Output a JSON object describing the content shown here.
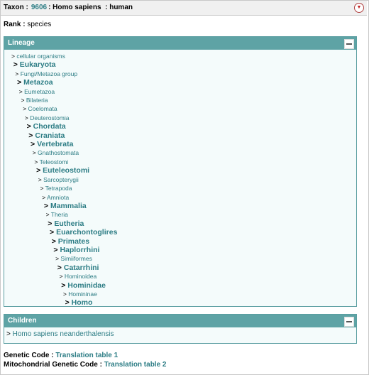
{
  "header": {
    "taxon_label": "Taxon :",
    "taxid": "9606",
    "name_sep": ": Homo sapiens",
    "common_sep": ": human"
  },
  "rank": {
    "label": "Rank :",
    "value": "species"
  },
  "lineage": {
    "title": "Lineage",
    "items": [
      {
        "name": "cellular organisms",
        "emph": false
      },
      {
        "name": "Eukaryota",
        "emph": true
      },
      {
        "name": "Fungi/Metazoa group",
        "emph": false
      },
      {
        "name": "Metazoa",
        "emph": true
      },
      {
        "name": "Eumetazoa",
        "emph": false
      },
      {
        "name": "Bilateria",
        "emph": false
      },
      {
        "name": "Coelomata",
        "emph": false
      },
      {
        "name": "Deuterostomia",
        "emph": false
      },
      {
        "name": "Chordata",
        "emph": true
      },
      {
        "name": "Craniata",
        "emph": true
      },
      {
        "name": "Vertebrata",
        "emph": true
      },
      {
        "name": "Gnathostomata",
        "emph": false
      },
      {
        "name": "Teleostomi",
        "emph": false
      },
      {
        "name": "Euteleostomi",
        "emph": true
      },
      {
        "name": "Sarcopterygii",
        "emph": false
      },
      {
        "name": "Tetrapoda",
        "emph": false
      },
      {
        "name": "Amniota",
        "emph": false
      },
      {
        "name": "Mammalia",
        "emph": true
      },
      {
        "name": "Theria",
        "emph": false
      },
      {
        "name": "Eutheria",
        "emph": true
      },
      {
        "name": "Euarchontoglires",
        "emph": true
      },
      {
        "name": "Primates",
        "emph": true
      },
      {
        "name": "Haplorrhini",
        "emph": true
      },
      {
        "name": "Simiiformes",
        "emph": false
      },
      {
        "name": "Catarrhini",
        "emph": true
      },
      {
        "name": "Hominoidea",
        "emph": false
      },
      {
        "name": "Hominidae",
        "emph": true
      },
      {
        "name": "Homininae",
        "emph": false
      },
      {
        "name": "Homo",
        "emph": true
      }
    ]
  },
  "children": {
    "title": "Children",
    "items": [
      {
        "name": "Homo sapiens neanderthalensis"
      }
    ]
  },
  "genetic_code": {
    "label": "Genetic Code :",
    "value": "Translation table 1"
  },
  "mito_code": {
    "label": "Mitochondrial Genetic Code :",
    "value": "Translation table 2"
  },
  "arrow": ">"
}
